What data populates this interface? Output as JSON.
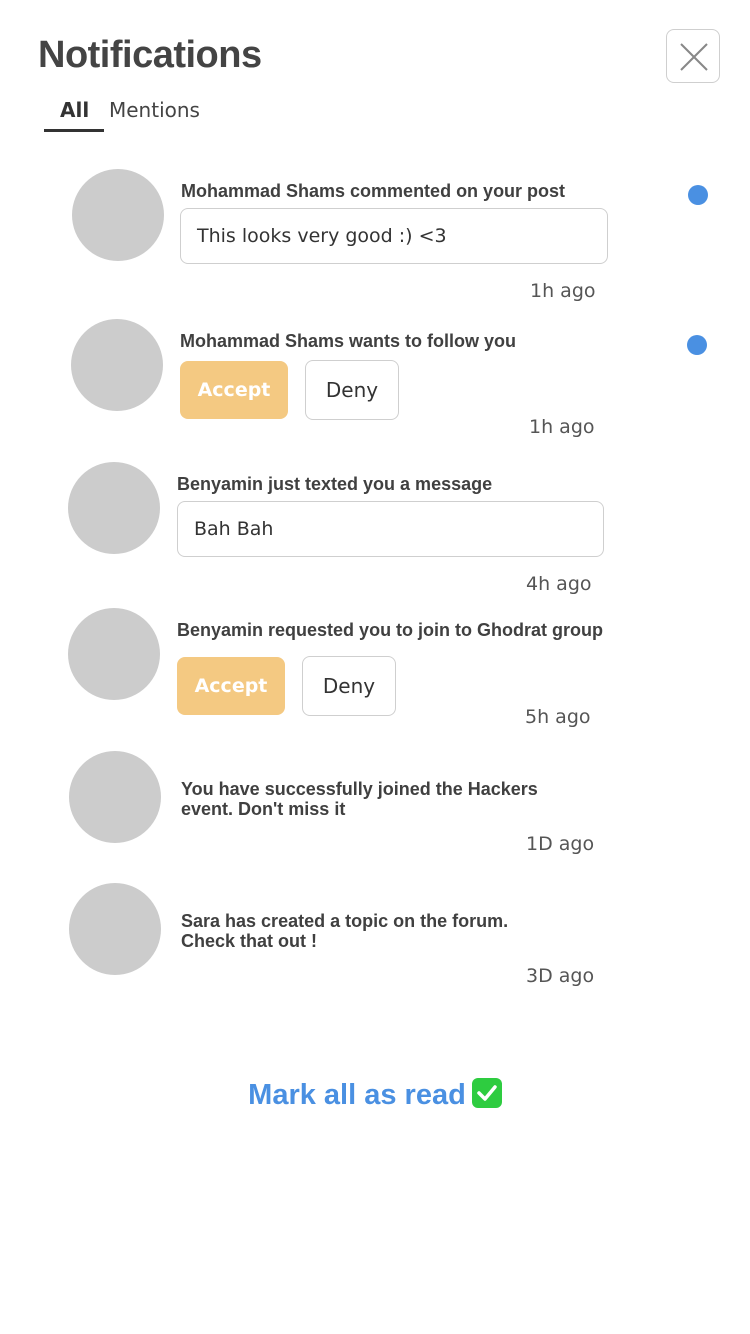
{
  "header": {
    "title": "Notifications",
    "close_label": "close"
  },
  "tabs": [
    {
      "label": "All",
      "active": true
    },
    {
      "label": "Mentions",
      "active": false
    }
  ],
  "notifications": [
    {
      "text": "Mohammad Shams commented on your post",
      "message": "This looks very good :) <3",
      "time": "1h ago",
      "unread": true
    },
    {
      "text": "Mohammad Shams wants to follow you",
      "accept_label": "Accept",
      "deny_label": "Deny",
      "time": "1h ago",
      "unread": true
    },
    {
      "text": "Benyamin just texted you a message",
      "message": "Bah Bah",
      "time": "4h ago",
      "unread": false
    },
    {
      "text": "Benyamin requested you to join to Ghodrat group",
      "accept_label": "Accept",
      "deny_label": "Deny",
      "time": "5h ago",
      "unread": false
    },
    {
      "text": "You have successfully joined the Hackers\nevent. Don't miss it",
      "time": "1D ago",
      "unread": false
    },
    {
      "text": "Sara has created a topic on the forum.\nCheck that out !",
      "time": "3D ago",
      "unread": false
    }
  ],
  "footer": {
    "mark_all_label": "Mark all as read"
  },
  "colors": {
    "accent": "#4a90e2",
    "accept_button": "#f4c982",
    "avatar": "#cccccc",
    "check_icon": "#2ecc40"
  }
}
